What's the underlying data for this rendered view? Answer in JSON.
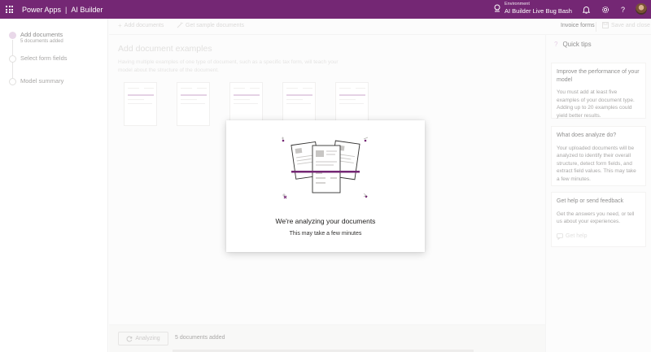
{
  "header": {
    "app_name": "Power Apps",
    "separator": "|",
    "product": "AI Builder",
    "environment_label": "Environment",
    "environment_name": "AI Builder Live Bug Bash"
  },
  "sidebar": {
    "steps": [
      {
        "label": "Add documents",
        "sub": "5 documents added",
        "state": "active"
      },
      {
        "label": "Select form fields",
        "state": "inactive"
      },
      {
        "label": "Model summary",
        "state": "inactive"
      }
    ]
  },
  "toolbar": {
    "add_documents": "Add documents",
    "get_sample": "Get sample documents",
    "invoice_forms": "Invoice forms",
    "save_close": "Save and close"
  },
  "main": {
    "title": "Add document examples",
    "description": "Having multiple examples of one type of document, such as a specific tax form, will teach your model about the structure of the document."
  },
  "footer": {
    "analyzing_label": "Analyzing",
    "documents_added": "5 documents added"
  },
  "tips": {
    "title": "Quick tips",
    "cards": [
      {
        "title": "Improve the performance of your model",
        "body": "You must add at least five examples of your document type. Adding up to 20 examples could yield better results."
      },
      {
        "title": "What does analyze do?",
        "body": "Your uploaded documents will be analyzed to identify their overall structure, detect form fields, and extract field values. This may take a few minutes."
      },
      {
        "title": "Get help or send feedback",
        "body": "Get the answers you need, or tell us about your experiences.",
        "link": "Get help"
      }
    ]
  },
  "dialog": {
    "title": "We're analyzing your documents",
    "subtitle": "This may take a few minutes"
  },
  "colors": {
    "brand": "#742774",
    "accent_light": "#d7b8d8",
    "scan_line": "#742774"
  },
  "icons": [
    "waffle-icon",
    "environment-icon",
    "bell-icon",
    "gear-icon",
    "help-icon",
    "plus-icon",
    "wand-icon",
    "save-icon",
    "refresh-icon",
    "help-circle-icon",
    "document-scan-illustration"
  ]
}
